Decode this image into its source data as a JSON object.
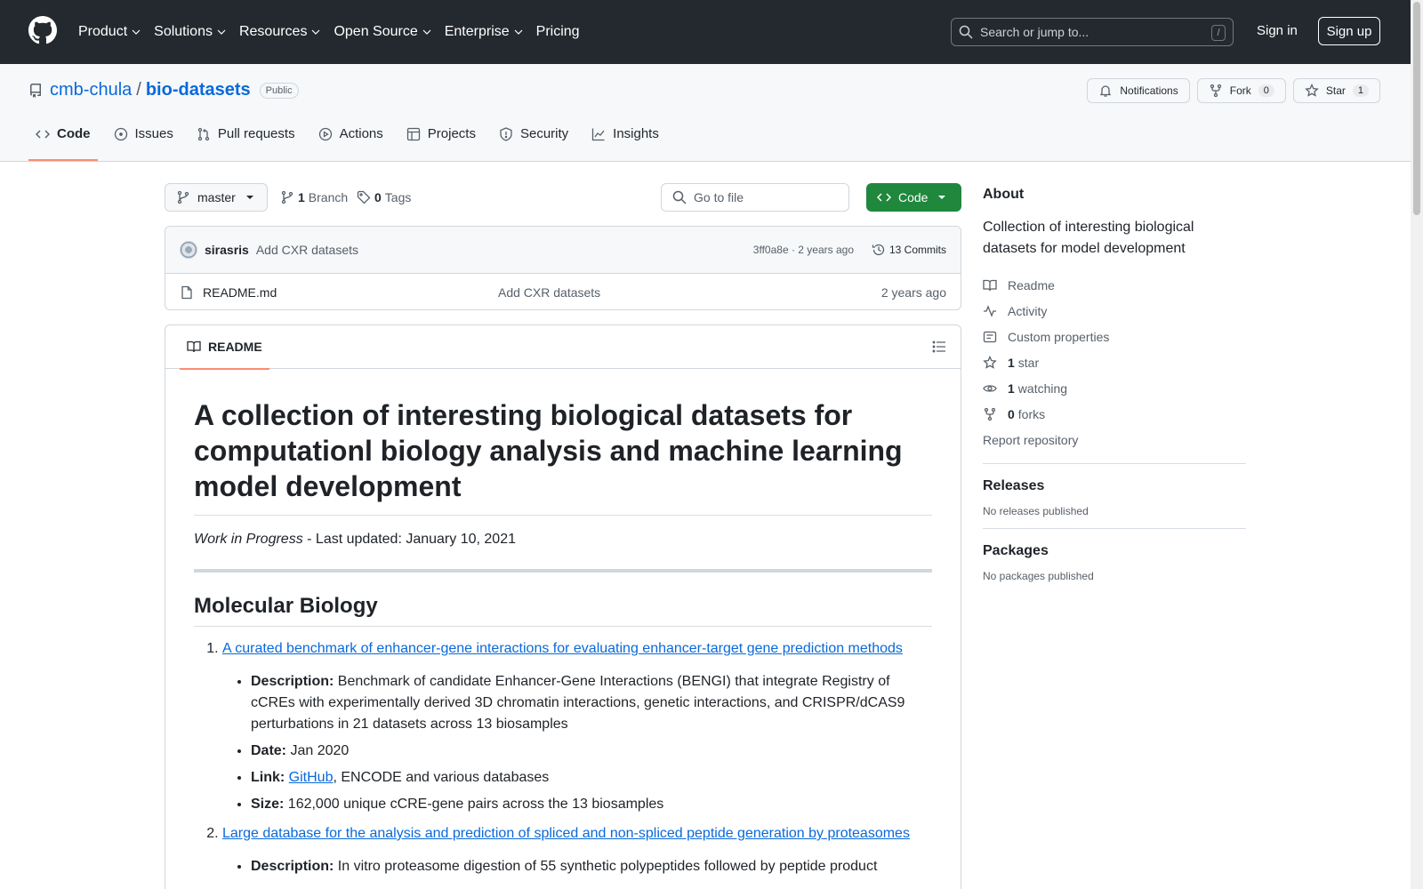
{
  "header": {
    "nav": [
      "Product",
      "Solutions",
      "Resources",
      "Open Source",
      "Enterprise",
      "Pricing"
    ],
    "search_placeholder": "Search or jump to...",
    "search_shortcut": "/",
    "signin": "Sign in",
    "signup": "Sign up"
  },
  "repo": {
    "owner": "cmb-chula",
    "separator": "/",
    "name": "bio-datasets",
    "visibility": "Public",
    "notifications": "Notifications",
    "fork_label": "Fork",
    "fork_count": "0",
    "star_label": "Star",
    "star_count": "1"
  },
  "tabs": [
    "Code",
    "Issues",
    "Pull requests",
    "Actions",
    "Projects",
    "Security",
    "Insights"
  ],
  "toolbar": {
    "branch": "master",
    "branch_count": "1",
    "branch_label": "Branch",
    "tag_count": "0",
    "tag_label": "Tags",
    "goto_placeholder": "Go to file",
    "code_button": "Code"
  },
  "commit": {
    "author": "sirasris",
    "message": "Add CXR datasets",
    "hash_age": "3ff0a8e · 2 years ago",
    "commits": "13 Commits"
  },
  "files": [
    {
      "name": "README.md",
      "message": "Add CXR datasets",
      "age": "2 years ago"
    }
  ],
  "readme": {
    "tab": "README",
    "title": "A collection of interesting biological datasets for computationl biology analysis and machine learning model development",
    "wip_italic": "Work in Progress",
    "wip_rest": " - Last updated: January 10, 2021",
    "section": "Molecular Biology",
    "items": [
      {
        "title": "A curated benchmark of enhancer-gene interactions for evaluating enhancer-target gene prediction methods",
        "desc_label": "Description:",
        "desc": " Benchmark of candidate Enhancer-Gene Interactions (BENGI) that integrate Registry of cCREs with experimentally derived 3D chromatin interactions, genetic interactions, and CRISPR/dCAS9 perturbations in 21 datasets across 13 biosamples",
        "date_label": "Date:",
        "date": " Jan 2020",
        "link_label": "Link:",
        "link_text": "GitHub",
        "link_rest": ", ENCODE and various databases",
        "size_label": "Size:",
        "size": " 162,000 unique cCRE-gene pairs across the 13 biosamples"
      },
      {
        "title": "Large database for the analysis and prediction of spliced and non-spliced peptide generation by proteasomes",
        "desc_label": "Description:",
        "desc": " In vitro proteasome digestion of 55 synthetic polypeptides followed by peptide product"
      }
    ]
  },
  "sidebar": {
    "about": "About",
    "description": "Collection of interesting biological datasets for model development",
    "links": {
      "readme": "Readme",
      "activity": "Activity",
      "custom": "Custom properties",
      "stars_count": "1",
      "stars": "star",
      "watching_count": "1",
      "watching": "watching",
      "forks_count": "0",
      "forks": "forks",
      "report": "Report repository"
    },
    "releases": "Releases",
    "no_releases": "No releases published",
    "packages": "Packages",
    "no_packages": "No packages published"
  },
  "colors": {
    "header_bg": "#24292f",
    "link": "#0969da",
    "primary": "#1f883d",
    "tab_underline": "#fd8c73"
  }
}
